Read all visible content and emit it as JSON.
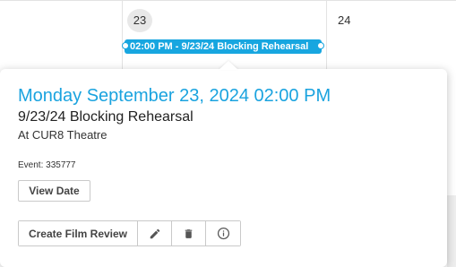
{
  "calendar": {
    "day_23": "23",
    "day_24": "24",
    "event_pill_label": "02:00 PM - 9/23/24 Blocking Rehearsal"
  },
  "popup": {
    "date_time": "Monday September 23, 2024 02:00 PM",
    "title": "9/23/24 Blocking Rehearsal",
    "location": "At CUR8 Theatre",
    "event_id_text": "Event: 335777",
    "view_date_label": "View Date",
    "create_film_review_label": "Create Film Review",
    "icons": [
      "pencil-icon",
      "trash-icon",
      "info-icon"
    ]
  },
  "colors": {
    "accent": "#1aa3df",
    "event_pill": "#17a6e0"
  }
}
